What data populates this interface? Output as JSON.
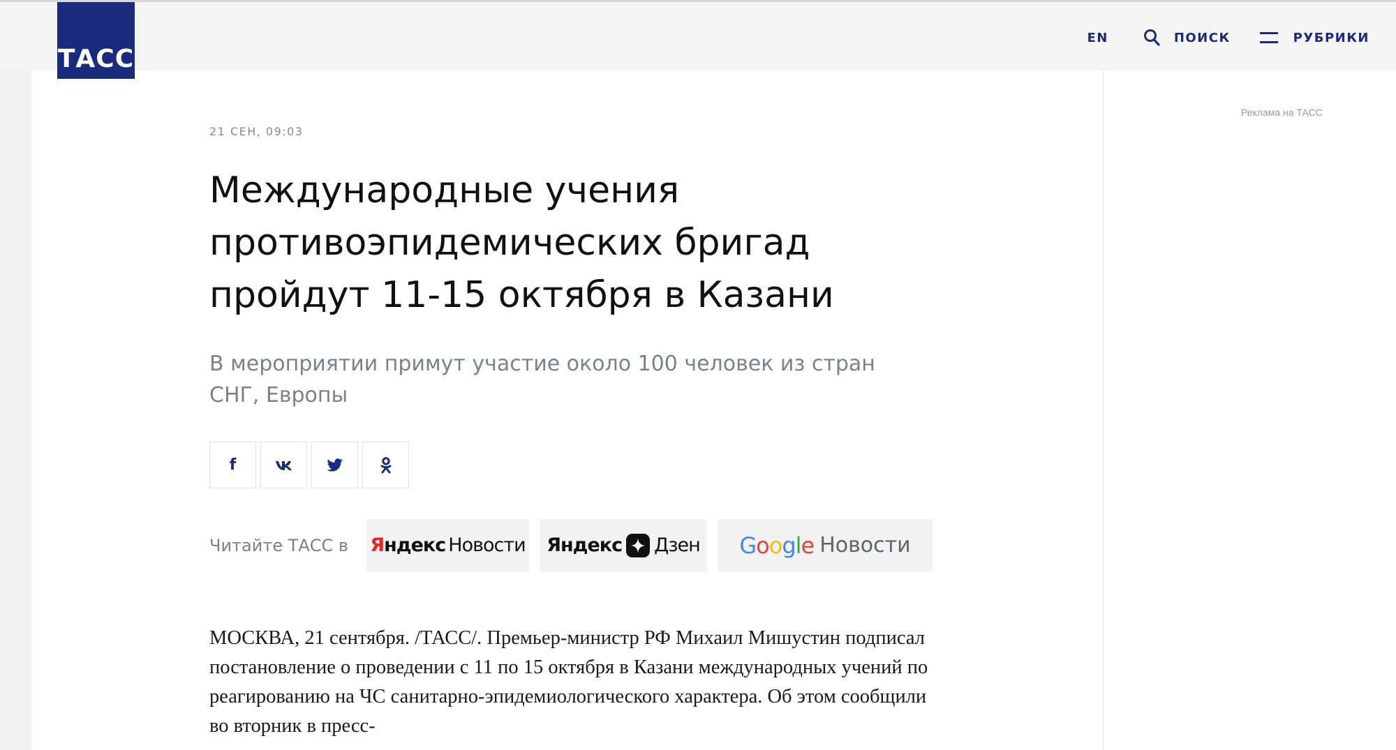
{
  "header": {
    "logo_text": "ТАСС",
    "nav": {
      "en_label": "EN",
      "search_label": "ПОИСК",
      "rubrics_label": "РУБРИКИ",
      "search_icon": "search-icon",
      "menu_icon": "menu-icon"
    }
  },
  "colors": {
    "brand_blue": "#1a2a7c",
    "yandex_red": "#e52620"
  },
  "article": {
    "date": "21 СЕН, 09:03",
    "title": "Международные учения противоэпидемических бригад пройдут 11-15 октября в Казани",
    "lead": "В мероприятии примут участие около 100 человек из стран СНГ, Европы",
    "share": [
      {
        "icon": "facebook-icon",
        "label": "f"
      },
      {
        "icon": "vk-icon",
        "label": "vk"
      },
      {
        "icon": "twitter-icon",
        "label": ""
      },
      {
        "icon": "odnoklassniki-icon",
        "label": ""
      }
    ],
    "read_in": {
      "label": "Читайте ТАСС в",
      "yandex_news": {
        "brand_first": "Я",
        "brand_rest": "ндекс",
        "word": "Новости"
      },
      "yandex_zen": {
        "brand": "Яндекс",
        "word": "Дзен"
      },
      "google_news": {
        "word": "Новости",
        "google_letters": [
          "G",
          "o",
          "o",
          "g",
          "l",
          "e"
        ]
      }
    },
    "body": "МОСКВА, 21 сентября. /ТАСС/. Премьер-министр РФ Михаил Мишустин подписал постановление о проведении с 11 по 15 октября в Казани международных учений по реагированию на ЧС санитарно-эпидемиологического характера. Об этом сообщили во вторник в пресс-"
  },
  "sidebar": {
    "ad_label": "Реклама на ТАСС"
  }
}
